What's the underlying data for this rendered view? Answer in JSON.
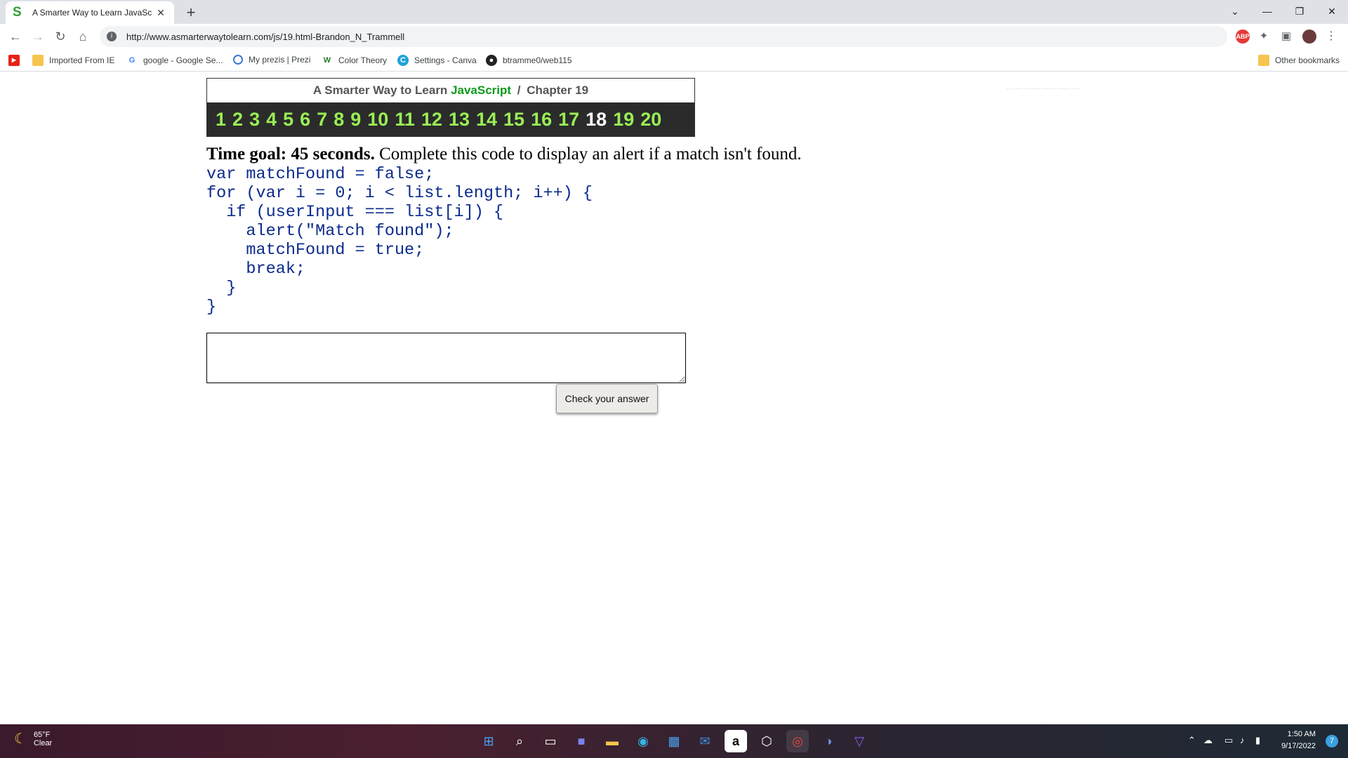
{
  "browser": {
    "tab_title": "A Smarter Way to Learn JavaScrip",
    "tab_favicon": "S",
    "url": "http://www.asmarterwaytolearn.com/js/19.html-Brandon_N_Trammell",
    "window_controls": [
      "⌄",
      "—",
      "❐",
      "✕"
    ]
  },
  "bookmarks": {
    "items": [
      {
        "label": "Imported From IE",
        "icon": "folder-icon"
      },
      {
        "label": "google - Google Se...",
        "icon": "google-icon"
      },
      {
        "label": "My prezis | Prezi",
        "icon": "prezi-icon"
      },
      {
        "label": "Color Theory",
        "icon": "w-icon"
      },
      {
        "label": "Settings - Canva",
        "icon": "canva-icon"
      },
      {
        "label": "btramme0/web115",
        "icon": "github-icon"
      }
    ],
    "other": "Other bookmarks"
  },
  "page": {
    "header_prefix": "A Smarter Way to Learn",
    "header_js": "JavaScript",
    "header_sep": "/",
    "header_chapter": "Chapter 19",
    "chapters": [
      "1",
      "2",
      "3",
      "4",
      "5",
      "6",
      "7",
      "8",
      "9",
      "10",
      "11",
      "12",
      "13",
      "14",
      "15",
      "16",
      "17",
      "18",
      "19",
      "20"
    ],
    "current_chapter": "18",
    "time_goal_label": "Time goal: 45 seconds.",
    "instruction": "Complete this code to display an alert if a match isn't found.",
    "code": "var matchFound = false;\nfor (var i = 0; i < list.length; i++) {\n  if (userInput === list[i]) {\n    alert(\"Match found\");\n    matchFound = true;\n    break;\n  }\n}",
    "answer_value": "",
    "check_button": "Check your answer"
  },
  "taskbar": {
    "temperature": "65°F",
    "condition": "Clear",
    "time": "1:50 AM",
    "date": "9/17/2022",
    "notification_count": "7"
  },
  "colors": {
    "accent_green": "#99ee55",
    "javascript_green": "#0a9b1b",
    "code_blue": "#0b2a8c",
    "nav_bg": "#2b2b2b"
  }
}
